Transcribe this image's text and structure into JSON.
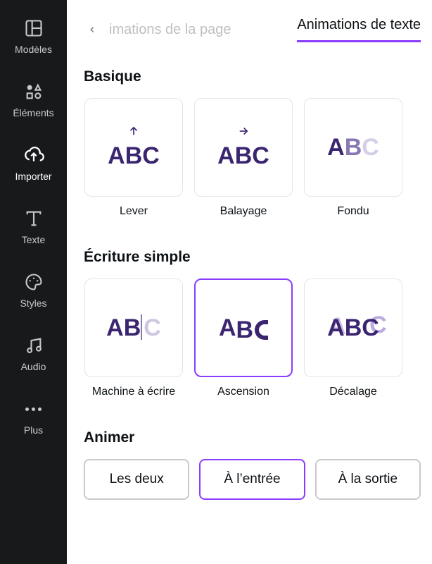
{
  "sidebar": {
    "items": [
      {
        "label": "Modèles"
      },
      {
        "label": "Éléments"
      },
      {
        "label": "Importer"
      },
      {
        "label": "Texte"
      },
      {
        "label": "Styles"
      },
      {
        "label": "Audio"
      },
      {
        "label": "Plus"
      }
    ],
    "active_index": 2
  },
  "tabs": {
    "page": "imations de la page",
    "text": "Animations de texte",
    "active": "text"
  },
  "sections": {
    "basic": {
      "title": "Basique",
      "items": [
        {
          "name": "Lever"
        },
        {
          "name": "Balayage"
        },
        {
          "name": "Fondu"
        }
      ]
    },
    "simple": {
      "title": "Écriture simple",
      "items": [
        {
          "name": "Machine à écrire"
        },
        {
          "name": "Ascension",
          "selected": true
        },
        {
          "name": "Décalage"
        }
      ]
    }
  },
  "animer": {
    "title": "Animer",
    "options": [
      {
        "label": "Les deux"
      },
      {
        "label": "À l’entrée",
        "selected": true
      },
      {
        "label": "À la sortie"
      }
    ]
  },
  "colors": {
    "accent": "#8b3dff",
    "text_dark": "#3b2571"
  }
}
